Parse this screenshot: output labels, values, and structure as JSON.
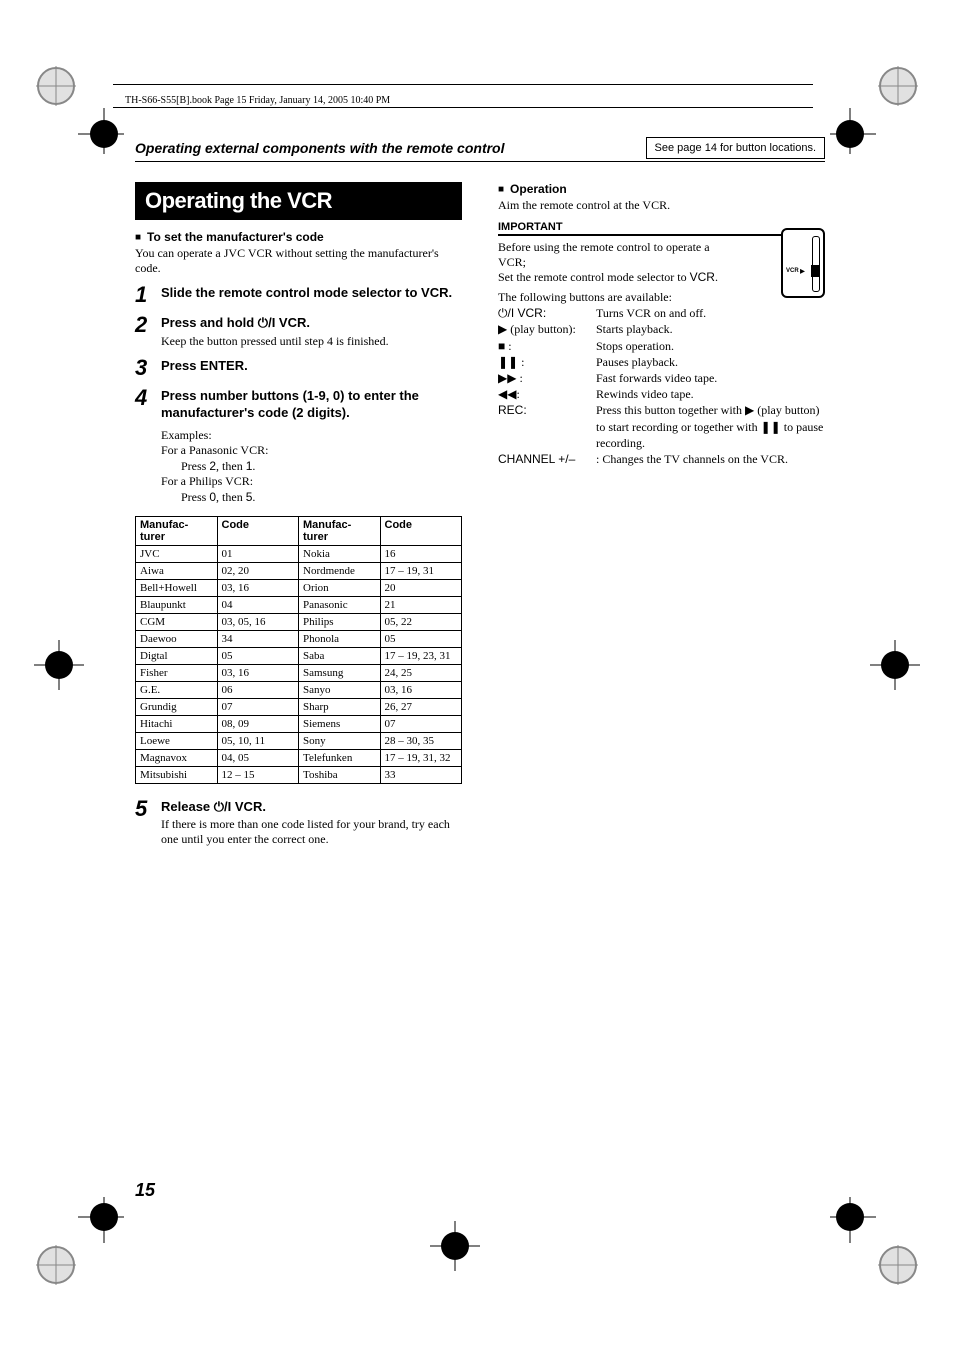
{
  "page_header": "TH-S66-S55[B].book  Page 15  Friday, January 14, 2005  10:40 PM",
  "section_title": "Operating external components with the remote control",
  "ref_note": "See page 14 for button locations.",
  "banner": "Operating the VCR",
  "sub_set_code": "To set the manufacturer's code",
  "intro_text": "You can operate a JVC VCR without setting the manufacturer's code.",
  "steps": {
    "1": {
      "text": "Slide the remote control mode selector to VCR."
    },
    "2": {
      "text": "Press and hold ⏻/I VCR.",
      "note": "Keep the button pressed until step 4 is finished."
    },
    "3": {
      "text": "Press ENTER."
    },
    "4": {
      "text": "Press number buttons (1-9, 0) to enter the manufacturer's code (2 digits)."
    },
    "5": {
      "text": "Release ⏻/I VCR.",
      "note": "If there is more than one code listed for your brand, try each one until you enter the correct one."
    }
  },
  "examples": {
    "label": "Examples:",
    "line1a": "For a Panasonic VCR:",
    "line1b_prefix": "Press ",
    "line1b_mid": ", then ",
    "line1b_v1": "2",
    "line1b_v2": "1",
    "line1b_suffix": ".",
    "line2a": "For a Philips VCR:",
    "line2b_v1": "0",
    "line2b_v2": "5"
  },
  "table": {
    "header_manu": "Manufac-turer",
    "header_code": "Code",
    "left": [
      {
        "m": "JVC",
        "c": "01"
      },
      {
        "m": "Aiwa",
        "c": "02, 20"
      },
      {
        "m": "Bell+Howell",
        "c": "03, 16"
      },
      {
        "m": "Blaupunkt",
        "c": "04"
      },
      {
        "m": "CGM",
        "c": "03, 05, 16"
      },
      {
        "m": "Daewoo",
        "c": "34"
      },
      {
        "m": "Digtal",
        "c": "05"
      },
      {
        "m": "Fisher",
        "c": "03, 16"
      },
      {
        "m": "G.E.",
        "c": "06"
      },
      {
        "m": "Grundig",
        "c": "07"
      },
      {
        "m": "Hitachi",
        "c": "08, 09"
      },
      {
        "m": "Loewe",
        "c": "05, 10, 11"
      },
      {
        "m": "Magnavox",
        "c": "04, 05"
      },
      {
        "m": "Mitsubishi",
        "c": "12 – 15"
      }
    ],
    "right": [
      {
        "m": "Nokia",
        "c": "16"
      },
      {
        "m": "Nordmende",
        "c": "17 – 19, 31"
      },
      {
        "m": "Orion",
        "c": "20"
      },
      {
        "m": "Panasonic",
        "c": "21"
      },
      {
        "m": "Philips",
        "c": "05, 22"
      },
      {
        "m": "Phonola",
        "c": "05"
      },
      {
        "m": "Saba",
        "c": "17 – 19, 23, 31"
      },
      {
        "m": "Samsung",
        "c": "24, 25"
      },
      {
        "m": "Sanyo",
        "c": "03, 16"
      },
      {
        "m": "Sharp",
        "c": "26, 27"
      },
      {
        "m": "Siemens",
        "c": "07"
      },
      {
        "m": "Sony",
        "c": "28 – 30, 35"
      },
      {
        "m": "Telefunken",
        "c": "17 – 19, 31, 32"
      },
      {
        "m": "Toshiba",
        "c": "33"
      }
    ]
  },
  "operation": {
    "heading": "Operation",
    "aim": "Aim the remote control at the VCR.",
    "important": "IMPORTANT",
    "important_text1": "Before using the remote control to operate a VCR;",
    "important_text2_pre": "Set the remote control mode selector to ",
    "important_text2_vcr": "VCR",
    "important_text2_post": ".",
    "list_intro": "The following buttons are available:",
    "rows": [
      {
        "key": "⏻/I VCR",
        "key_suffix": ":",
        "desc": "Turns VCR on and off.",
        "key_sans": true
      },
      {
        "key": "▶ (play button)",
        "key_suffix": ":",
        "desc": "Starts playback."
      },
      {
        "key": "■ ",
        "key_suffix": ":",
        "desc": "Stops operation."
      },
      {
        "key": "❚❚ ",
        "key_suffix": ":",
        "desc": "Pauses playback."
      },
      {
        "key": "▶▶ ",
        "key_suffix": ":",
        "desc": "Fast forwards video tape."
      },
      {
        "key": "◀◀",
        "key_suffix": ":",
        "desc": "Rewinds video tape."
      },
      {
        "key": "REC",
        "key_suffix": ":",
        "desc": "Press this button together with ▶ (play button) to start recording or together with ❚❚ to pause recording.",
        "key_sans": true
      }
    ],
    "channel_pre": "CHANNEL +/–",
    "channel_desc": ": Changes the TV channels on the VCR.",
    "remote_label": "VCR"
  },
  "page_num": "15"
}
